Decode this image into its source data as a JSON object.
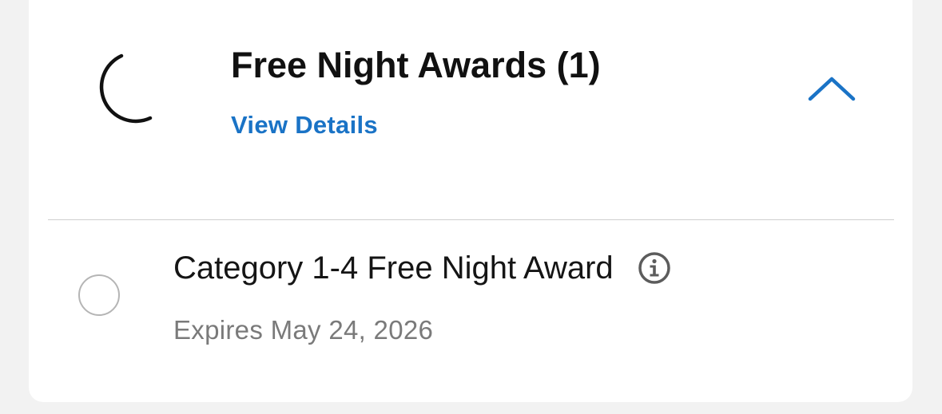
{
  "section": {
    "icon": "moon-icon",
    "title": "Free Night Awards (1)",
    "view_details_label": "View Details",
    "toggle_icon": "chevron-up-icon",
    "accent_color": "#1a73c6"
  },
  "awards": [
    {
      "name": "Category 1-4 Free Night Award",
      "info_icon": "info-icon",
      "expiry": "Expires May 24, 2026",
      "selected": false
    }
  ]
}
